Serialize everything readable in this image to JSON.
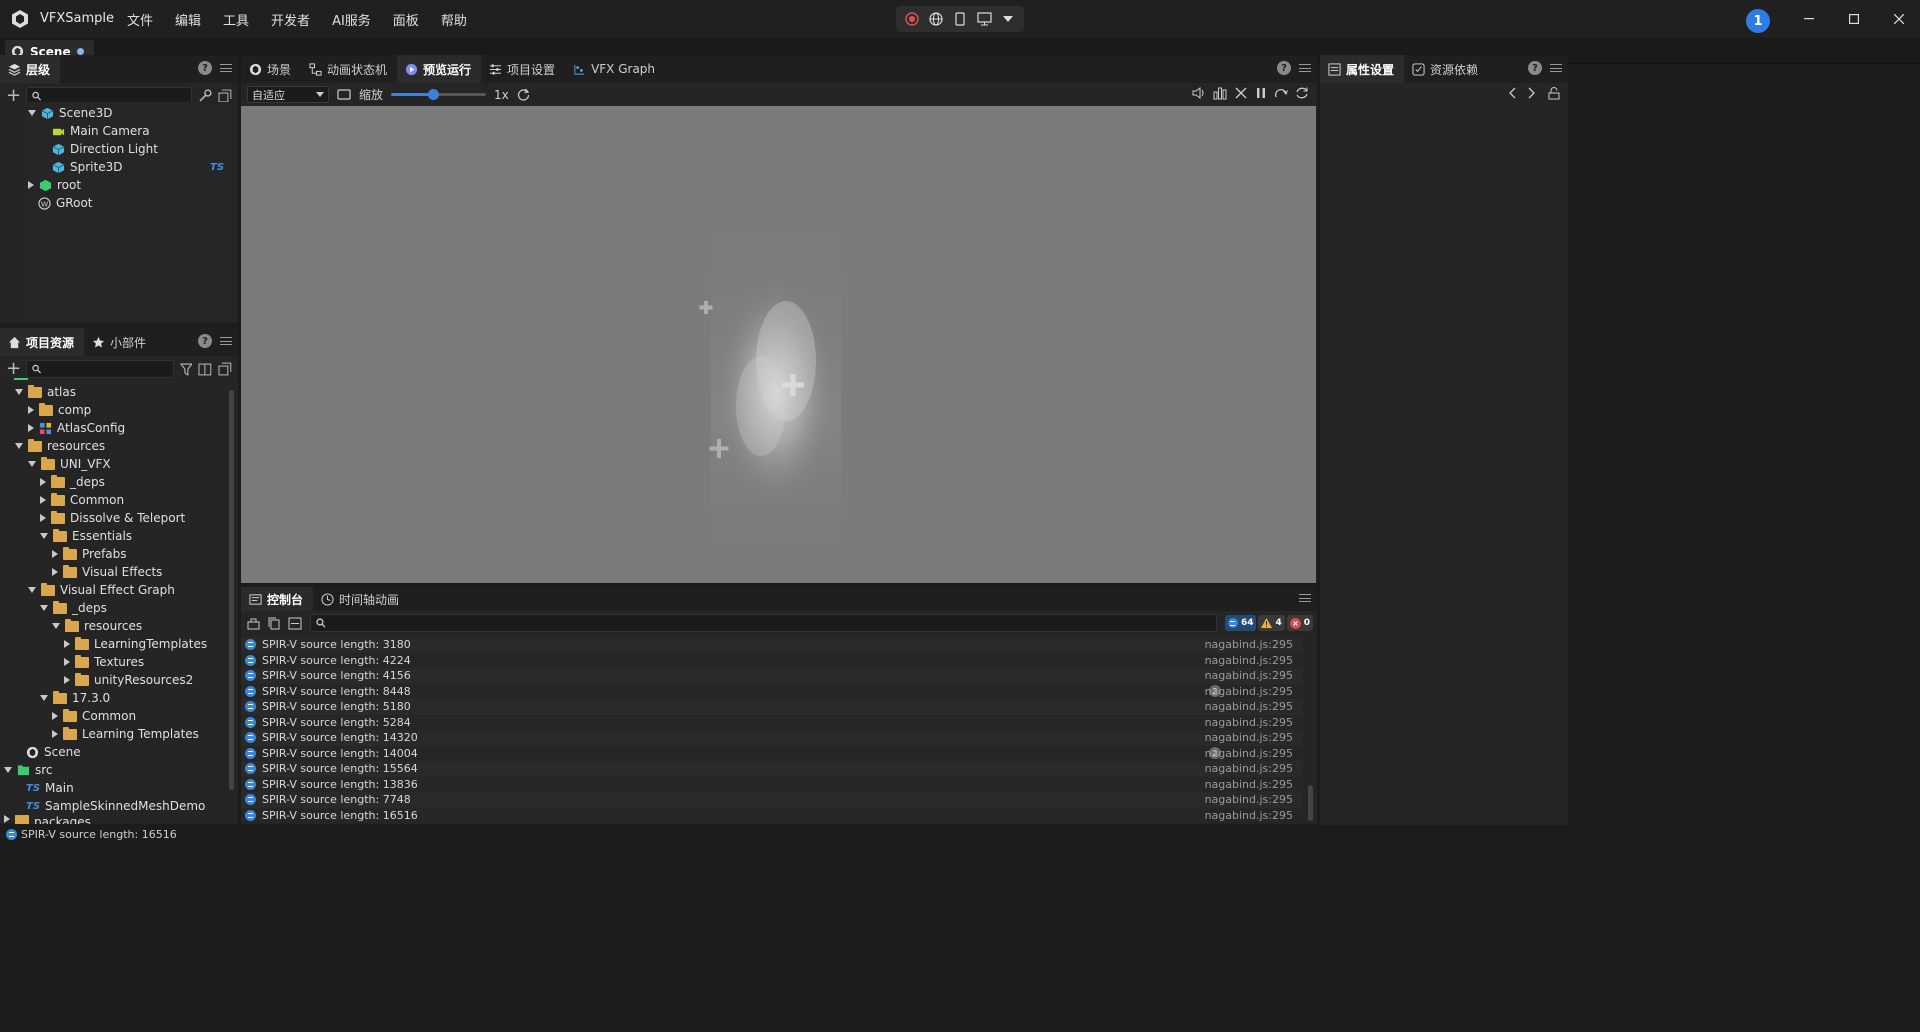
{
  "app": {
    "name": "VFXSample",
    "menu": [
      "文件",
      "编辑",
      "工具",
      "开发者",
      "AI服务",
      "面板",
      "帮助"
    ],
    "user_badge": "1"
  },
  "scene_tab": {
    "label": "Scene"
  },
  "hierarchy": {
    "tab_label": "层级",
    "search_placeholder": "",
    "items": [
      {
        "label": "Scene3D",
        "icon": "cube-icon"
      },
      {
        "label": "Main Camera",
        "icon": "camera-icon"
      },
      {
        "label": "Direction Light",
        "icon": "cube-icon"
      },
      {
        "label": "Sprite3D",
        "icon": "cube-icon",
        "tag": "TS"
      },
      {
        "label": "root",
        "icon": "node-icon"
      },
      {
        "label": "GRoot",
        "icon": "widget-icon"
      }
    ]
  },
  "assets": {
    "tabs": [
      "项目资源",
      "小部件"
    ],
    "search_placeholder": "",
    "items": [
      {
        "label": "atlas"
      },
      {
        "label": "comp"
      },
      {
        "label": "AtlasConfig"
      },
      {
        "label": "resources"
      },
      {
        "label": "UNI_VFX"
      },
      {
        "label": "_deps"
      },
      {
        "label": "Common"
      },
      {
        "label": "Dissolve & Teleport"
      },
      {
        "label": "Essentials"
      },
      {
        "label": "Prefabs"
      },
      {
        "label": "Visual Effects"
      },
      {
        "label": "Visual Effect Graph"
      },
      {
        "label": "_deps"
      },
      {
        "label": "resources"
      },
      {
        "label": "LearningTemplates"
      },
      {
        "label": "Textures"
      },
      {
        "label": "unityResources2"
      },
      {
        "label": "17.3.0"
      },
      {
        "label": "Common"
      },
      {
        "label": "Learning Templates"
      },
      {
        "label": "Scene"
      },
      {
        "label": "src"
      },
      {
        "label": "Main",
        "prefix": "TS"
      },
      {
        "label": "SampleSkinnedMeshDemo",
        "prefix": "TS"
      },
      {
        "label": "packages"
      }
    ]
  },
  "center": {
    "tabs": [
      "场景",
      "动画状态机",
      "预览运行",
      "项目设置",
      "VFX Graph"
    ],
    "active_tab": "预览运行",
    "fit_select": "自适应",
    "zoom_label": "缩放",
    "zoom_value": "1x",
    "zoom_fraction": 0.45
  },
  "inspector": {
    "tabs": [
      "属性设置",
      "资源依赖"
    ]
  },
  "console": {
    "tabs": [
      "控制台",
      "时间轴动画"
    ],
    "search_placeholder": "",
    "counts": {
      "info": "64",
      "warn": "4",
      "error": "0"
    },
    "logs": [
      {
        "text": "SPIR-V source length:  3180",
        "src": "nagabind.js:295"
      },
      {
        "text": "SPIR-V source length:  4224",
        "src": "nagabind.js:295"
      },
      {
        "text": "SPIR-V source length:  4156",
        "src": "nagabind.js:295"
      },
      {
        "text": "SPIR-V source length:  8448",
        "src": "nagabind.js:295",
        "count": "2"
      },
      {
        "text": "SPIR-V source length:  5180",
        "src": "nagabind.js:295"
      },
      {
        "text": "SPIR-V source length:  5284",
        "src": "nagabind.js:295"
      },
      {
        "text": "SPIR-V source length:  14320",
        "src": "nagabind.js:295"
      },
      {
        "text": "SPIR-V source length:  14004",
        "src": "nagabind.js:295",
        "count": "2"
      },
      {
        "text": "SPIR-V source length:  15564",
        "src": "nagabind.js:295"
      },
      {
        "text": "SPIR-V source length:  13836",
        "src": "nagabind.js:295"
      },
      {
        "text": "SPIR-V source length:  7748",
        "src": "nagabind.js:295"
      },
      {
        "text": "SPIR-V source length:  16516",
        "src": "nagabind.js:295"
      }
    ]
  },
  "status": {
    "text": "SPIR-V source length:  16516"
  }
}
